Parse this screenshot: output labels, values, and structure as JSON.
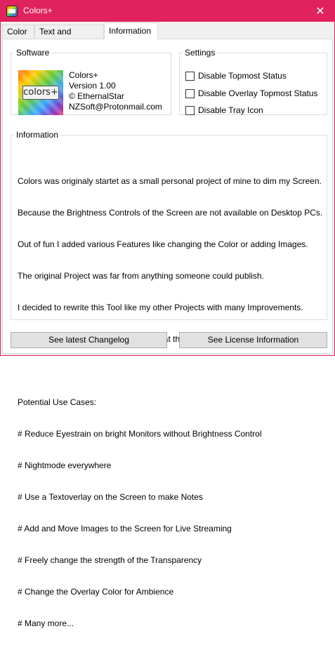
{
  "window": {
    "title": "Colors+",
    "accent_color": "#e0225f",
    "close_symbol": "✕"
  },
  "tabs": [
    {
      "label": "Color",
      "active": false
    },
    {
      "label": "Text and Images",
      "active": false
    },
    {
      "label": "Information",
      "active": true
    }
  ],
  "software": {
    "legend": "Software",
    "logo_text": "colors+",
    "lines": [
      "Colors+",
      "Version 1.00",
      "© EthernalStar",
      "NZSoft@Protonmail.com"
    ]
  },
  "settings": {
    "legend": "Settings",
    "options": [
      {
        "label": "Disable Topmost Status",
        "checked": false
      },
      {
        "label": "Disable Overlay Topmost Status",
        "checked": false
      },
      {
        "label": "Disable Tray Icon",
        "checked": false
      }
    ]
  },
  "information": {
    "legend": "Information",
    "lines": [
      "Colors was originaly startet as a small personal project of mine to dim my Screen.",
      "Because the Brightness Controls of the Screen are not available on Desktop PCs.",
      "Out of fun I added various Features like changing the Color or adding Images.",
      "The original Project was far from anything someone could publish.",
      "I decided to rewrite this Tool like my other Projects with many Improvements.",
      "Now the name is Colors+ and I hope that this Project helps someone.",
      "",
      "Potential Use Cases:",
      "# Reduce Eyestrain on bright Monitors without Brightness Control",
      "# Nightmode everywhere",
      "# Use a Textoverlay on the Screen to make Notes",
      "# Add and Move Images to the Screen for Live Streaming",
      "# Freely change the strength of the Transparency",
      "# Change the Overlay Color for Ambience",
      "# Many more..."
    ]
  },
  "buttons": {
    "changelog": "See latest Changelog",
    "license": "See License Information"
  }
}
